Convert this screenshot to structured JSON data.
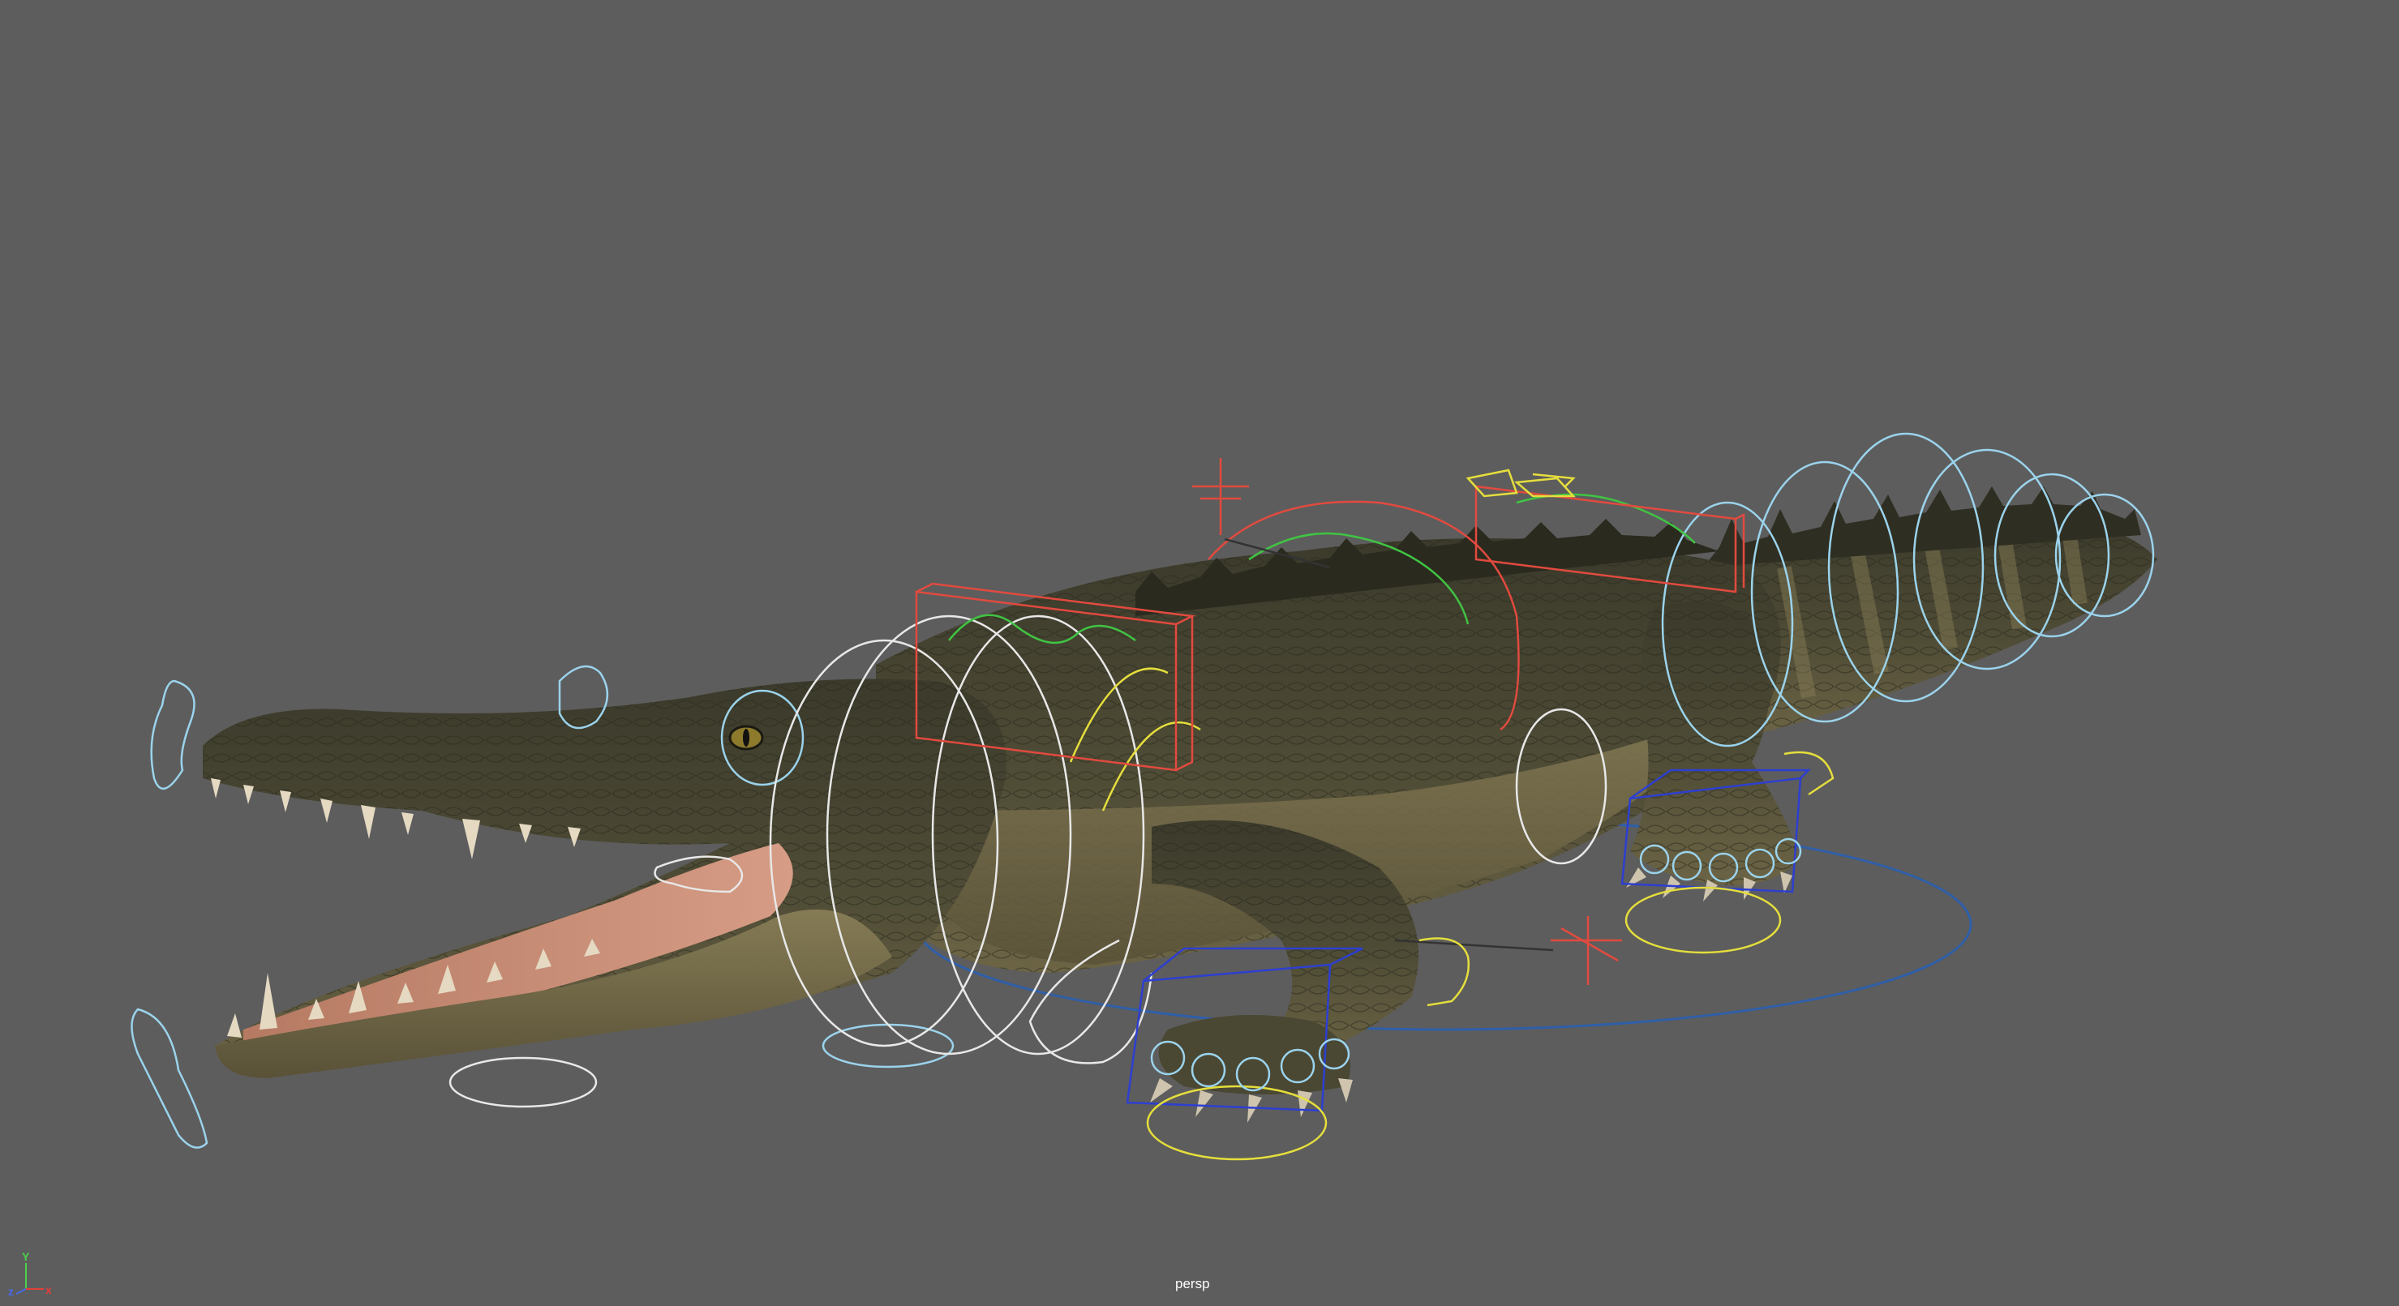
{
  "viewport": {
    "camera_name": "persp",
    "background_color": "#5d5d5d"
  },
  "axis_indicator": {
    "x_label": "x",
    "y_label": "Y",
    "z_label": "z",
    "x_color": "#e0403a",
    "y_color": "#49d24a",
    "z_color": "#4a6ae8"
  },
  "scene_object": {
    "name": "crocodile-model",
    "skin_color": "#4c4a33",
    "belly_color": "#7f7652",
    "mouth_color": "#c98a72",
    "teeth_color": "#e5d9c2"
  },
  "rig_colors": {
    "fk_controls": "#9bd3ec",
    "spine_controls": "#e8e8e8",
    "ik_handles": "#e24a3f",
    "pole_vectors": "#2d3fd1",
    "ground_control": "#2f5fa8",
    "foot_roll": "#e5de3c",
    "misc": "#40c443"
  }
}
